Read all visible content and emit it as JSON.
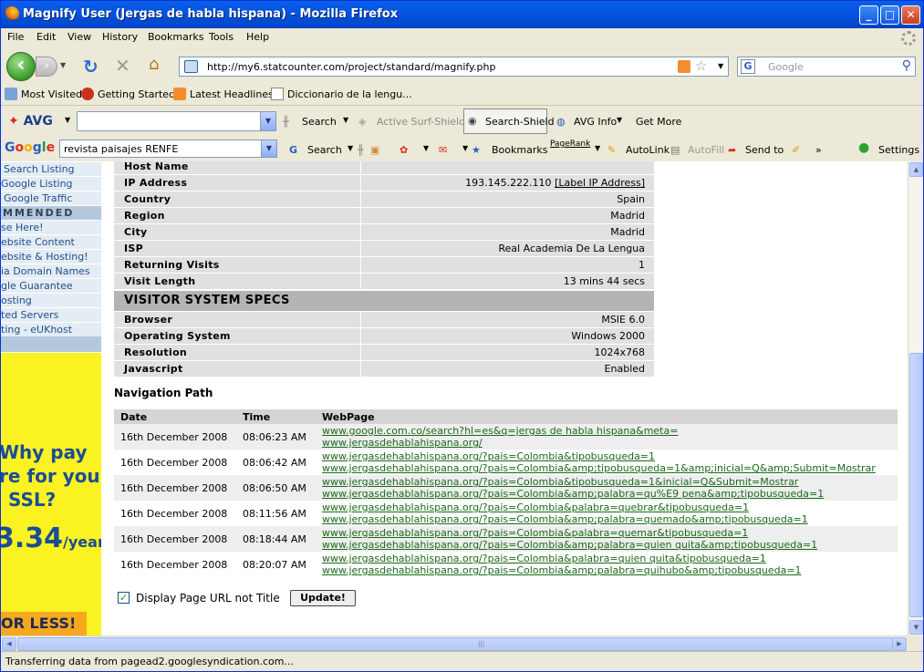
{
  "window": {
    "title": "Magnify User (Jergas de habla hispana) - Mozilla Firefox"
  },
  "menu": [
    "File",
    "Edit",
    "View",
    "History",
    "Bookmarks",
    "Tools",
    "Help"
  ],
  "nav": {
    "url": "http://my6.statcounter.com/project/standard/magnify.php",
    "search_placeholder": "Google"
  },
  "bookmarks": [
    "Most Visited",
    "Getting Started",
    "Latest Headlines",
    "Diccionario de la lengu..."
  ],
  "avg": {
    "logo": "AVG",
    "search": "Search",
    "active_surf": "Active Surf-Shield",
    "search_shield": "Search-Shield",
    "info": "AVG Info",
    "get_more": "Get More"
  },
  "google": {
    "logo": "Google",
    "query": "revista paisajes RENFE",
    "search": "Search",
    "bookmarks": "Bookmarks",
    "pagerank": "PageRank",
    "autolink": "AutoLink",
    "autofill": "AutoFill",
    "sendto": "Send to",
    "more": "»",
    "settings": "Settings"
  },
  "sidebar": {
    "items": [
      "Search Listing",
      "Google Listing",
      "Google Traffic",
      "MMENDED",
      "se Here!",
      "ebsite Content",
      "ebsite & Hosting!",
      "ia Domain Names",
      "gle Guarantee",
      "osting",
      "ted Servers",
      "ting - eUKhost"
    ]
  },
  "ad": {
    "line1": "Why pay",
    "line2": "re for your",
    "line3": "SSL?",
    "price": "3.34",
    "unit": "/year",
    "cta": "OR LESS!"
  },
  "visitor": [
    {
      "k": "Host Name",
      "v": ""
    },
    {
      "k": "IP Address",
      "v": "193.145.222.110",
      "link": "[Label IP Address]"
    },
    {
      "k": "Country",
      "v": "Spain"
    },
    {
      "k": "Region",
      "v": "Madrid"
    },
    {
      "k": "City",
      "v": "Madrid"
    },
    {
      "k": "ISP",
      "v": "Real Academia De La Lengua"
    },
    {
      "k": "Returning Visits",
      "v": "1"
    },
    {
      "k": "Visit Length",
      "v": "13 mins 44 secs"
    }
  ],
  "system_header": "VISITOR SYSTEM SPECS",
  "system": [
    {
      "k": "Browser",
      "v": "MSIE 6.0"
    },
    {
      "k": "Operating System",
      "v": "Windows 2000"
    },
    {
      "k": "Resolution",
      "v": "1024x768"
    },
    {
      "k": "Javascript",
      "v": "Enabled"
    }
  ],
  "navpath": {
    "title": "Navigation Path",
    "headers": [
      "Date",
      "Time",
      "WebPage"
    ],
    "rows": [
      {
        "date": "16th December 2008",
        "time": "08:06:23 AM",
        "links": [
          "www.google.com.co/search?hl=es&q=jergas de habla hispana&meta=",
          "www.jergasdehablahispana.org/"
        ]
      },
      {
        "date": "16th December 2008",
        "time": "08:06:42 AM",
        "links": [
          "www.jergasdehablahispana.org/?pais=Colombia&tipobusqueda=1",
          "www.jergasdehablahispana.org/?pais=Colombia&amp;tipobusqueda=1&amp;inicial=Q&amp;Submit=Mostrar"
        ]
      },
      {
        "date": "16th December 2008",
        "time": "08:06:50 AM",
        "links": [
          "www.jergasdehablahispana.org/?pais=Colombia&tipobusqueda=1&inicial=Q&Submit=Mostrar",
          "www.jergasdehablahispana.org/?pais=Colombia&amp;palabra=qu%E9 pena&amp;tipobusqueda=1"
        ]
      },
      {
        "date": "16th December 2008",
        "time": "08:11:56 AM",
        "links": [
          "www.jergasdehablahispana.org/?pais=Colombia&palabra=quebrar&tipobusqueda=1",
          "www.jergasdehablahispana.org/?pais=Colombia&amp;palabra=quemado&amp;tipobusqueda=1"
        ]
      },
      {
        "date": "16th December 2008",
        "time": "08:18:44 AM",
        "links": [
          "www.jergasdehablahispana.org/?pais=Colombia&palabra=quemar&tipobusqueda=1",
          "www.jergasdehablahispana.org/?pais=Colombia&amp;palabra=quien quita&amp;tipobusqueda=1"
        ]
      },
      {
        "date": "16th December 2008",
        "time": "08:20:07 AM",
        "links": [
          "www.jergasdehablahispana.org/?pais=Colombia&palabra=quien quita&tipobusqueda=1",
          "www.jergasdehablahispana.org/?pais=Colombia&amp;palabra=quihubo&amp;tipobusqueda=1"
        ]
      }
    ]
  },
  "options": {
    "checkbox_label": "Display Page URL not Title",
    "update": "Update!"
  },
  "status": "Transferring data from pagead2.googlesyndication.com..."
}
